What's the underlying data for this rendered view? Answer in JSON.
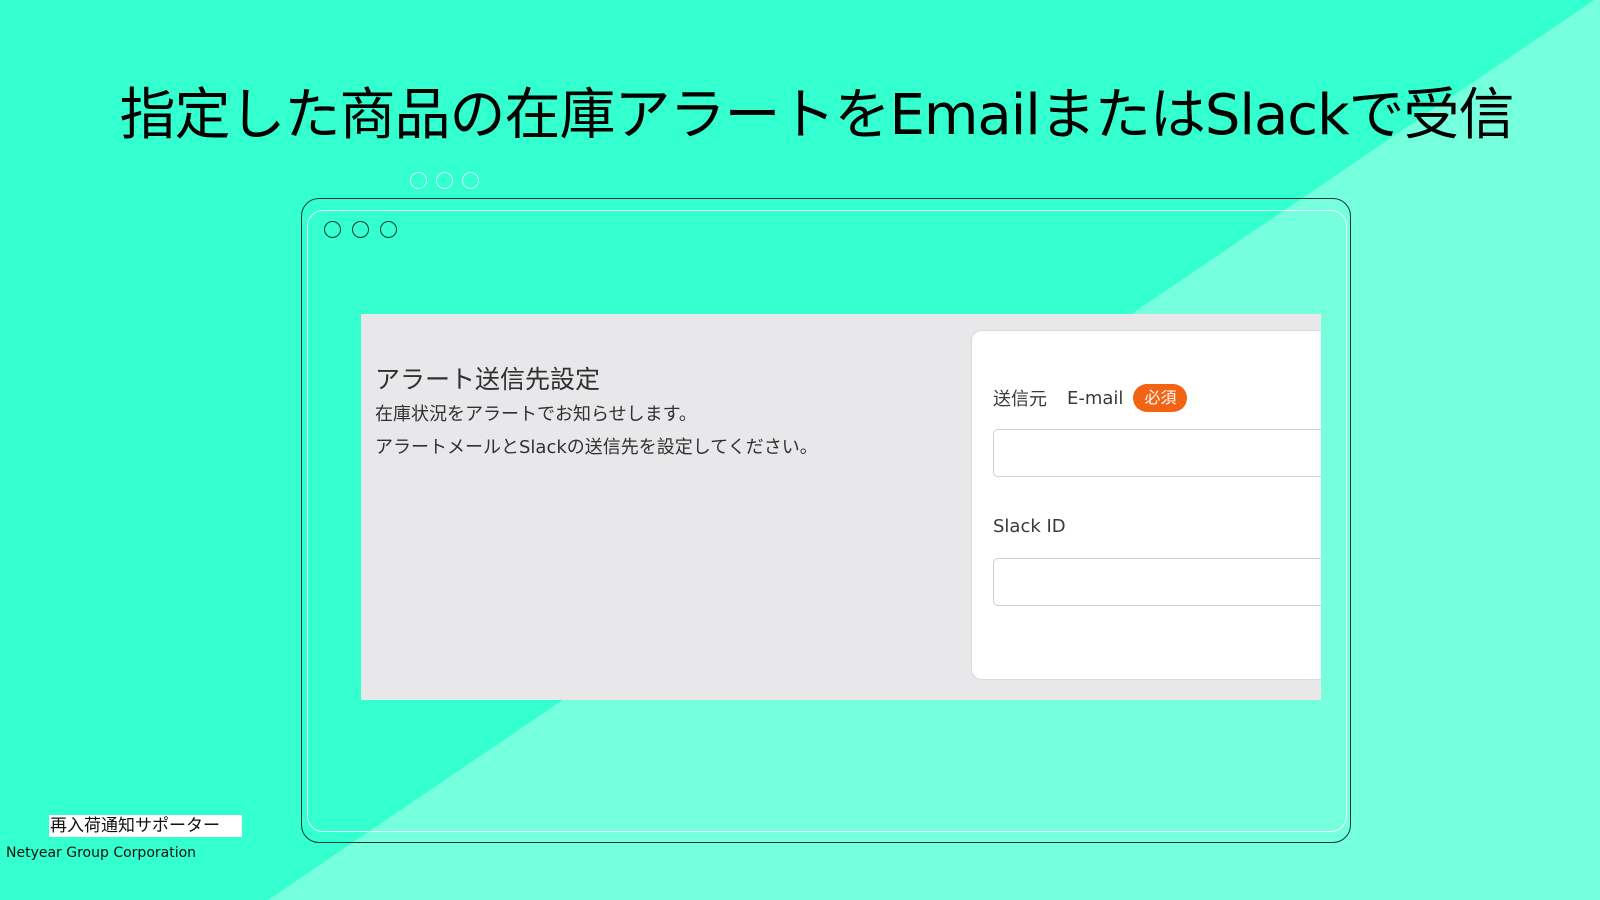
{
  "headline": "指定した商品の在庫アラートをEmailまたはSlackで受信",
  "colors": {
    "background": "#33ffcf",
    "background_light": "#76ffdd",
    "panel_bg": "#e8e8ea",
    "badge": "#f26314"
  },
  "window_controls": [
    "circle",
    "circle",
    "circle"
  ],
  "panel": {
    "title": "アラート送信先設定",
    "description_lines": [
      "在庫状況をアラートでお知らせします。",
      "アラートメールとSlackの送信先を設定してください。"
    ]
  },
  "form": {
    "sender_email": {
      "label_prefix": "送信元",
      "label": "E-mail",
      "required_badge": "必須",
      "value": "",
      "placeholder": ""
    },
    "slack_id": {
      "label": "Slack ID",
      "value": "",
      "placeholder": ""
    }
  },
  "footer": {
    "app_name": "再入荷通知サポーター",
    "company": "Netyear Group Corporation"
  }
}
